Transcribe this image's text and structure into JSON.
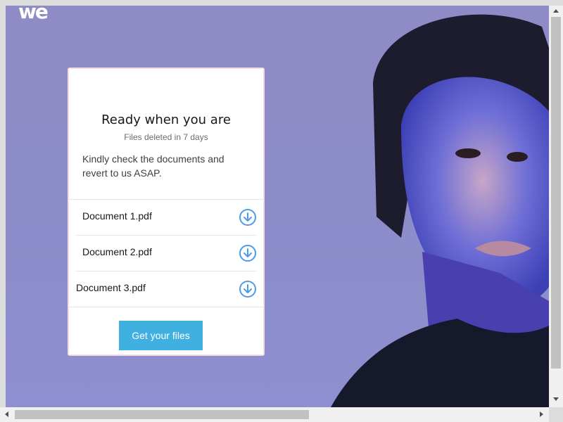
{
  "brand": {
    "logo_text": "we"
  },
  "card": {
    "title": "Ready when you are",
    "subtitle": "Files deleted in 7 days",
    "message": "Kindly check the documents and revert to us ASAP.",
    "files": [
      {
        "name": "Document 1.pdf",
        "icon": "download-circle-icon"
      },
      {
        "name": "Document 2.pdf",
        "icon": "download-circle-icon"
      },
      {
        "name": "Document 3.pdf",
        "icon": "download-circle-icon"
      }
    ],
    "button_label": "Get your files"
  },
  "colors": {
    "background": "#8e8dc9",
    "accent_button": "#40b0e0",
    "download_icon": "#4a9be8"
  }
}
